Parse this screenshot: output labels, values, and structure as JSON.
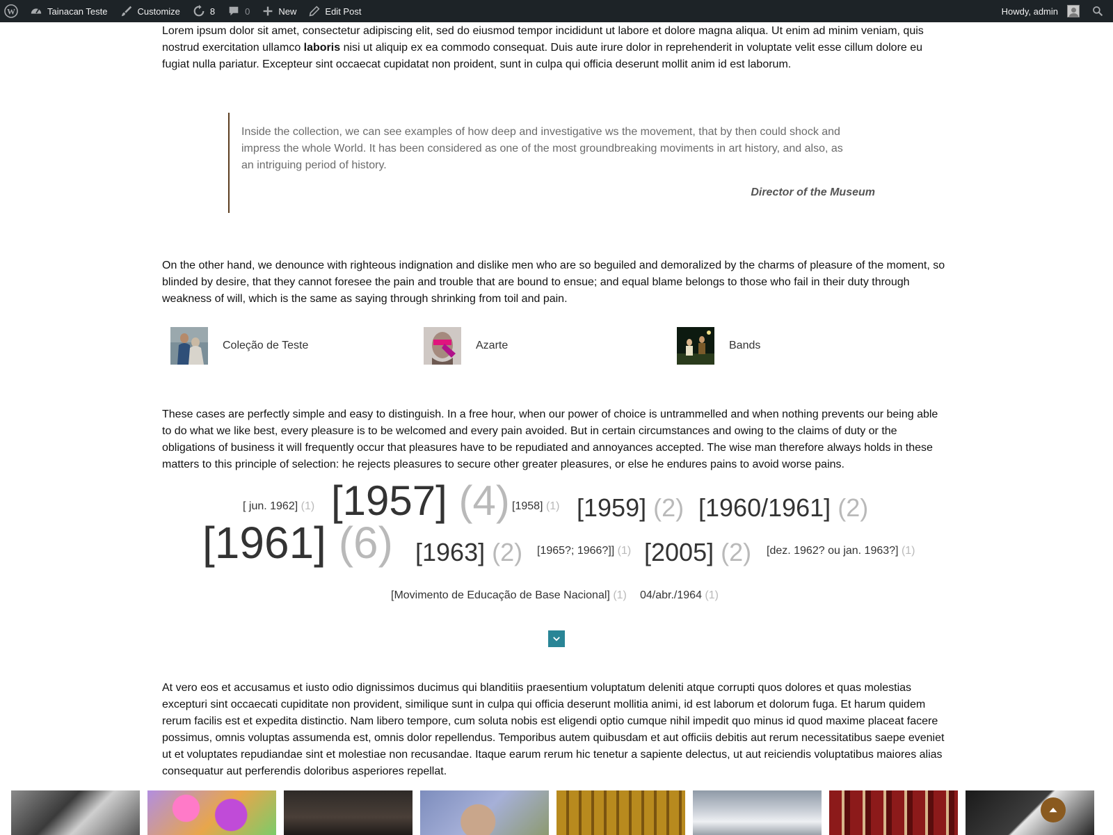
{
  "adminbar": {
    "site_name": "Tainacan Teste",
    "customize": "Customize",
    "updates_count": "8",
    "comments_count": "0",
    "new_label": "New",
    "edit_label": "Edit Post",
    "howdy": "Howdy, admin"
  },
  "content": {
    "para1_a": "Lorem ipsum dolor sit amet, consectetur adipiscing elit, sed do eiusmod tempor incididunt ut labore et dolore magna aliqua. Ut enim ad minim veniam, quis nostrud exercitation ullamco ",
    "para1_bold": "laboris",
    "para1_b": " nisi ut aliquip ex ea commodo consequat. Duis aute irure dolor in reprehenderit in voluptate velit esse cillum dolore eu fugiat nulla pariatur. Excepteur sint occaecat cupidatat non proident, sunt in culpa qui officia deserunt mollit anim id est laborum.",
    "quote_text": "Inside the collection, we can see examples of how deep and investigative ws the movement, that by then could shock and impress the whole World. It has been considered as one of the most groundbreaking moviments in art history, and also, as an intriguing period of history.",
    "quote_cite": "Director of the Museum",
    "para2": "On the other hand, we denounce with righteous indignation and dislike men who are so beguiled and demoralized by the charms of pleasure of the moment, so blinded by desire, that they cannot foresee the pain and trouble that are bound to ensue; and equal blame belongs to those who fail in their duty through weakness of will, which is the same as saying through shrinking from toil and pain.",
    "para3": "These cases are perfectly simple and easy to distinguish. In a free hour, when our power of choice is untrammelled and when nothing prevents our being able to do what we like best, every pleasure is to be welcomed and every pain avoided. But in certain circumstances and owing to the claims of duty or the obligations of business it will frequently occur that pleasures have to be repudiated and annoyances accepted. The wise man therefore always holds in these matters to this principle of selection: he rejects pleasures to secure other greater pleasures, or else he endures pains to avoid worse pains.",
    "para4": "At vero eos et accusamus et iusto odio dignissimos ducimus qui blanditiis praesentium voluptatum deleniti atque corrupti quos dolores et quas molestias excepturi sint occaecati cupiditate non provident, similique sunt in culpa qui officia deserunt mollitia animi, id est laborum et dolorum fuga. Et harum quidem rerum facilis est et expedita distinctio. Nam libero tempore, cum soluta nobis est eligendi optio cumque nihil impedit quo minus id quod maxime placeat facere possimus, omnis voluptas assumenda est, omnis dolor repellendus. Temporibus autem quibusdam et aut officiis debitis aut rerum necessitatibus saepe eveniet ut et voluptates repudiandae sint et molestiae non recusandae. Itaque earum rerum hic tenetur a sapiente delectus, ut aut reiciendis voluptatibus maiores alias consequatur aut perferendis doloribus asperiores repellat."
  },
  "collections": [
    {
      "label": "Coleção de Teste"
    },
    {
      "label": "Azarte"
    },
    {
      "label": "Bands"
    }
  ],
  "tags": [
    {
      "term": "[ jun. 1962]",
      "count": "(1)"
    },
    {
      "term": "[1957]",
      "count": "(4)"
    },
    {
      "term": "[1958]",
      "count": "(1)"
    },
    {
      "term": "[1959]",
      "count": "(2)"
    },
    {
      "term": "[1960/1961]",
      "count": "(2)"
    },
    {
      "term": "[1961]",
      "count": "(6)"
    },
    {
      "term": "[1963]",
      "count": "(2)"
    },
    {
      "term": "[1965?; 1966?]]",
      "count": "(1)"
    },
    {
      "term": "[2005]",
      "count": "(2)"
    },
    {
      "term": "[dez. 1962? ou jan. 1963?]",
      "count": "(1)"
    },
    {
      "term": "[Movimento de Educação de Base Nacional]",
      "count": "(1)"
    },
    {
      "term": "04/abr./1964",
      "count": "(1)"
    }
  ],
  "icons": {
    "wp": "wordpress-logo-icon",
    "dashboard": "dashboard-icon",
    "customize": "paintbrush-icon",
    "updates": "refresh-icon",
    "comments": "comment-bubble-icon",
    "new": "plus-icon",
    "edit": "pencil-icon",
    "search": "search-icon",
    "more": "chevron-down-icon",
    "back_to_top": "arrow-up-icon"
  },
  "colors": {
    "adminbar": "#1d2327",
    "quote_border": "#5b3d1f",
    "tag_count": "#b9b9b9",
    "more_button": "#298596",
    "back_to_top": "#8a5a1f"
  }
}
